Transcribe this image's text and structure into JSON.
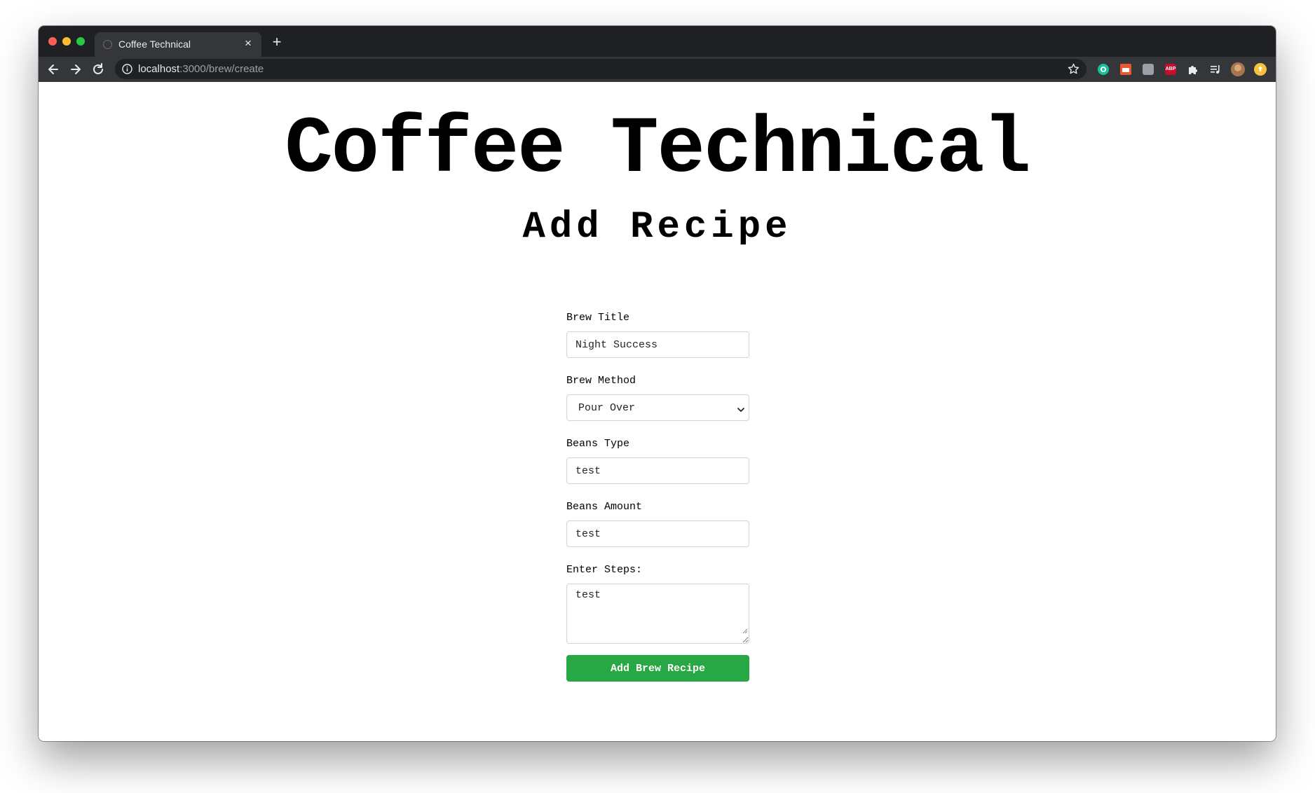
{
  "browser": {
    "tab_title": "Coffee Technical",
    "url_host": "localhost",
    "url_path": ":3000/brew/create",
    "extensions": [
      "grammarly-icon",
      "calendar-extension-icon",
      "gray-extension-icon",
      "abp-icon",
      "puzzle-icon",
      "media-queue-icon",
      "profile-avatar",
      "update-icon"
    ],
    "abp_label": "ABP"
  },
  "page": {
    "site_title": "Coffee Technical",
    "heading": "Add Recipe"
  },
  "form": {
    "brew_title_label": "Brew Title",
    "brew_title_value": "Night Success",
    "brew_method_label": "Brew Method",
    "brew_method_value": "Pour Over",
    "beans_type_label": "Beans Type",
    "beans_type_value": "test",
    "beans_amount_label": "Beans Amount",
    "beans_amount_value": "test",
    "steps_label": "Enter Steps:",
    "steps_value": "test",
    "submit_label": "Add Brew Recipe"
  },
  "colors": {
    "submit_bg": "#28a745",
    "chrome_bg": "#1f2023",
    "toolbar_bg": "#35363a"
  }
}
